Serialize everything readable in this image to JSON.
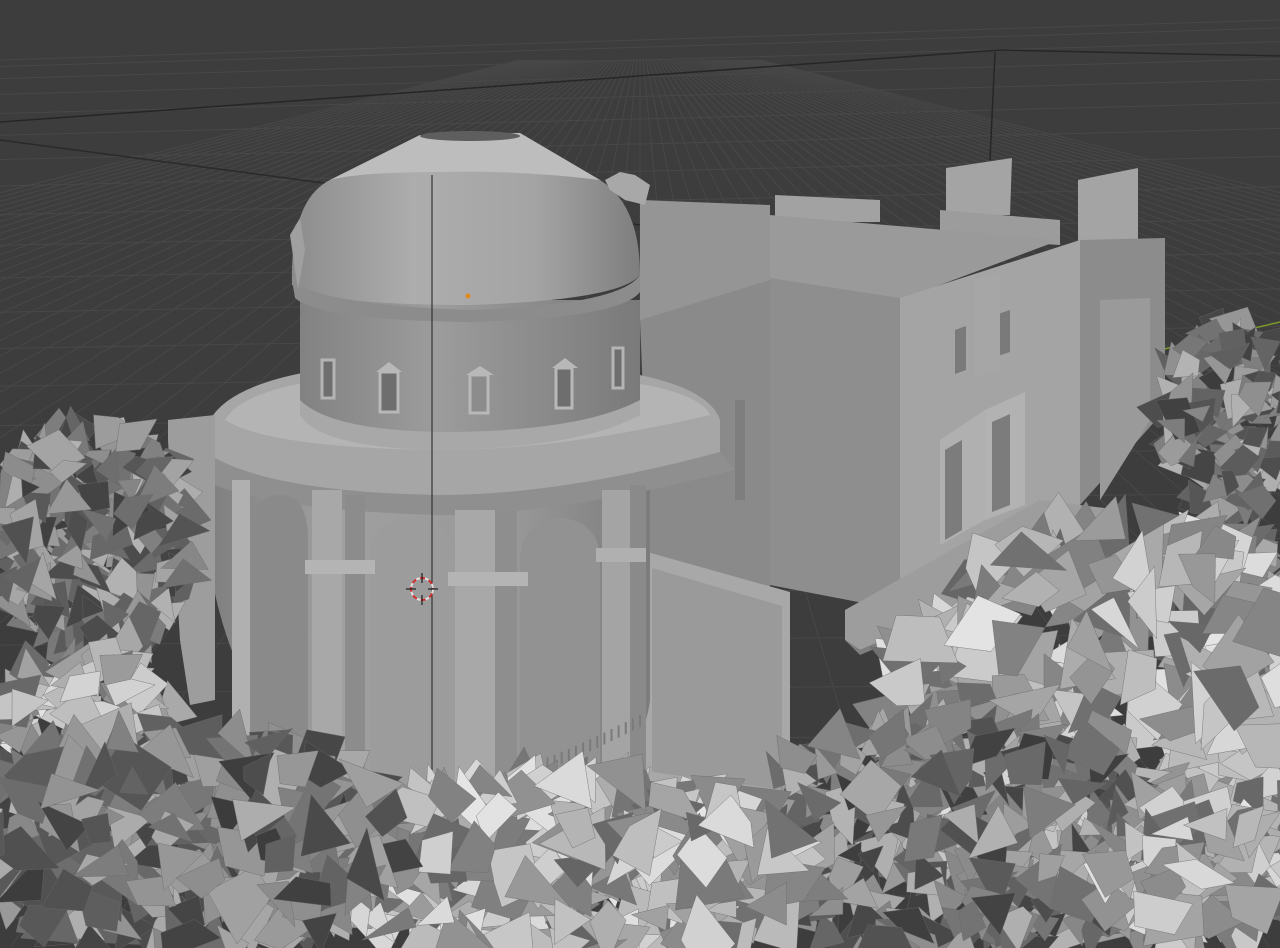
{
  "viewport": {
    "mode": "3d-viewport",
    "shading": "solid",
    "background_color": "#3d3d3d",
    "grid_color": "#4a4a4a",
    "horizon_line_color": "#262626",
    "x_axis_color": "#b03a48",
    "y_axis_color": "#7a9a2a",
    "model_color": "#9a9a9a"
  },
  "scene": {
    "objects": [
      "domed-rotunda",
      "annex-building",
      "boundary-wall",
      "tree-left",
      "tree-right",
      "foliage-foreground"
    ],
    "cursor": "3d-cursor",
    "origin": "object-origin-dot"
  }
}
